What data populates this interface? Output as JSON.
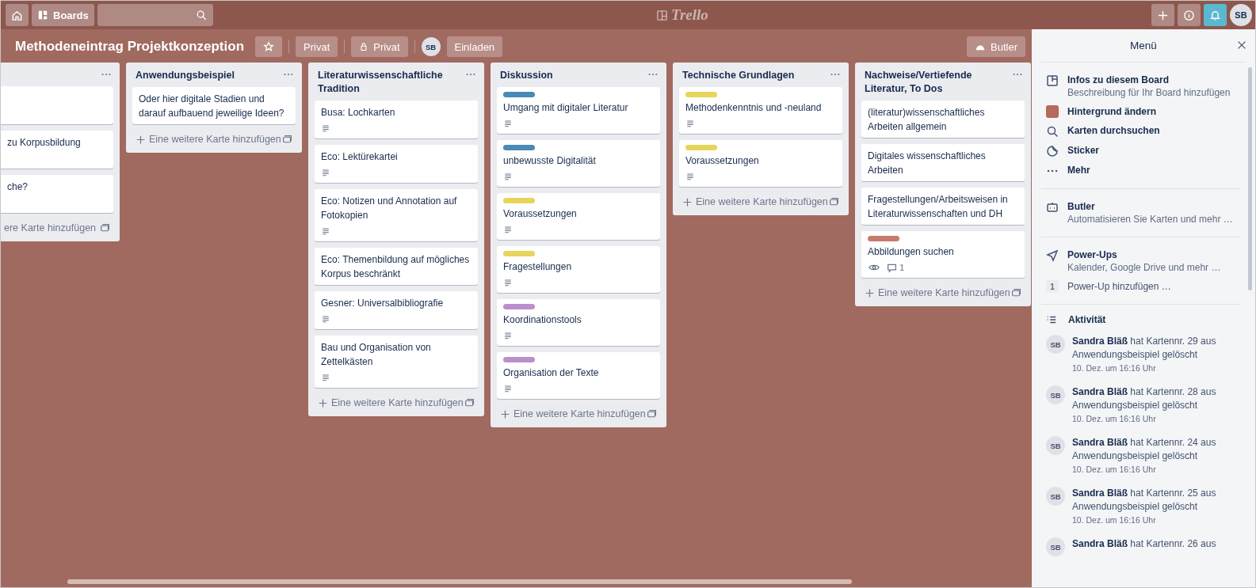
{
  "topbar": {
    "boards_label": "Boards",
    "logo": "Trello",
    "avatar": "SB"
  },
  "board": {
    "title": "Methodeneintrag Projektkonzeption",
    "team_visibility": "Privat",
    "visibility": "Privat",
    "member": "SB",
    "invite": "Einladen",
    "butler": "Butler"
  },
  "lists": [
    {
      "cards": [
        {
          "kind": "empty"
        },
        {
          "title": "zu Korpusbildung"
        },
        {
          "title": "che?"
        }
      ],
      "add_card": "ere Karte hinzufügen",
      "cut": true
    },
    {
      "title": "Anwendungsbeispiel",
      "cards": [
        {
          "title": "Oder hier digitale Stadien und darauf aufbauend jeweilige Ideen?"
        }
      ],
      "add_card": "Eine weitere Karte hinzufügen",
      "cut": false
    },
    {
      "title": "Literaturwissenschaftliche Tradition",
      "cards": [
        {
          "title": "Busa: Lochkarten",
          "description": true
        },
        {
          "title": "Eco: Lektürekartei",
          "description": true
        },
        {
          "title": "Eco: Notizen und Annotation auf Fotokopien",
          "description": true
        },
        {
          "title": "Eco: Themenbildung auf mögliches Korpus beschränkt",
          "description": false
        },
        {
          "title": "Gesner: Universalbibliografie",
          "description": true
        },
        {
          "title": "Bau und Organisation von Zettelkästen",
          "description": true
        }
      ],
      "add_card": "Eine weitere Karte hinzufügen",
      "cut": false
    },
    {
      "title": "Diskussion",
      "cards": [
        {
          "title": "Umgang mit digitaler Literatur",
          "color": "#4a8ab5",
          "description": true
        },
        {
          "title": "unbewusste Digitalität",
          "color": "#4a8ab5",
          "description": true
        },
        {
          "title": "Voraussetzungen",
          "color": "#e6d55a",
          "description": true
        },
        {
          "title": "Fragestellungen",
          "color": "#e6d55a",
          "description": true
        },
        {
          "title": "Koordinationstools",
          "color": "#bb8fcc",
          "description": true
        },
        {
          "title": "Organisation der Texte",
          "color": "#bb8fcc",
          "description": true
        }
      ],
      "add_card": "Eine weitere Karte hinzufügen",
      "cut": false
    },
    {
      "title": "Technische Grundlagen",
      "cards": [
        {
          "title": "Methodenkenntnis und -neuland",
          "color": "#e6d55a",
          "description": true
        },
        {
          "title": "Voraussetzungen",
          "color": "#e6d55a",
          "description": true
        }
      ],
      "add_card": "Eine weitere Karte hinzufügen",
      "cut": false
    },
    {
      "title": "Nachweise/Vertiefende Literatur, To Dos",
      "cards": [
        {
          "title": "(literatur)wissenschaftliches Arbeiten allgemein"
        },
        {
          "title": "Digitales wissenschaftliches Arbeiten"
        },
        {
          "title": "Fragestellungen/Arbeitsweisen in Literaturwissenschaften und DH"
        },
        {
          "title": "Abbildungen suchen",
          "color": "#c97a6c",
          "watching": true,
          "comments": "1"
        }
      ],
      "add_card": "Eine weitere Karte hinzufügen",
      "cut": false
    }
  ],
  "menu": {
    "title": "Menü",
    "sections": [
      {
        "items": [
          {
            "kind": "board",
            "title": "Infos zu diesem Board",
            "subtitle": "Beschreibung für Ihr Board hinzufügen"
          },
          {
            "kind": "background",
            "title": "Hintergrund ändern",
            "color": "#b46a5c"
          },
          {
            "kind": "search",
            "title": "Karten durchsuchen"
          },
          {
            "kind": "sticker",
            "title": "Sticker"
          },
          {
            "kind": "more",
            "title": "Mehr"
          }
        ]
      },
      {
        "items": [
          {
            "kind": "butler",
            "title": "Butler",
            "subtitle": "Automatisieren Sie Karten und mehr …"
          }
        ]
      },
      {
        "items": [
          {
            "kind": "powerups",
            "title": "Power-Ups",
            "subtitle": "Kalender, Google Drive und mehr …"
          },
          {
            "kind": "count",
            "count": "1",
            "title": "Power-Up hinzufügen …"
          }
        ]
      }
    ],
    "activity_title": "Aktivität",
    "activity": [
      {
        "avatar": "SB",
        "text": "**Sandra Bläß** hat Kartennr. 29 aus Anwendungsbeispiel gelöscht",
        "time": "10. Dez. um 16:16 Uhr"
      },
      {
        "avatar": "SB",
        "text": "**Sandra Bläß** hat Kartennr. 28 aus Anwendungsbeispiel gelöscht",
        "time": "10. Dez. um 16:16 Uhr"
      },
      {
        "avatar": "SB",
        "text": "**Sandra Bläß** hat Kartennr. 24 aus Anwendungsbeispiel gelöscht",
        "time": "10. Dez. um 16:16 Uhr"
      },
      {
        "avatar": "SB",
        "text": "**Sandra Bläß** hat Kartennr. 25 aus Anwendungsbeispiel gelöscht",
        "time": "10. Dez. um 16:16 Uhr"
      },
      {
        "avatar": "SB",
        "text": "**Sandra Bläß** hat Kartennr. 26 aus"
      }
    ]
  }
}
